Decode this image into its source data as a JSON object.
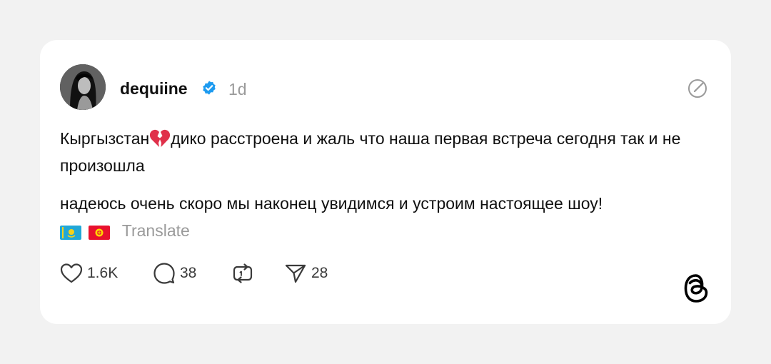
{
  "post": {
    "username": "dequiine",
    "time": "1d",
    "paragraph1_before_emoji": "Кыргызстан",
    "paragraph1_after_emoji": "дико расстроена и жаль что наша первая встреча сегодня так и не произошла",
    "paragraph2": "надеюсь очень скоро мы наконец увидимся и устроим настоящее шоу!",
    "translate_label": "Translate",
    "emoji": [
      "broken-heart",
      "flag-kazakhstan",
      "flag-kyrgyzstan"
    ]
  },
  "actions": {
    "likes": "1.6K",
    "replies": "38",
    "reposts": "",
    "shares": "28"
  },
  "colors": {
    "background": "#f2f2f2",
    "card": "#ffffff",
    "verified": "#1d9bf0",
    "muted": "#9a9a9a",
    "text": "#101010"
  }
}
